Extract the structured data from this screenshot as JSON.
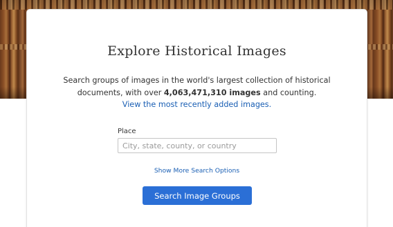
{
  "hero": {
    "image": "old-book-spines-banner"
  },
  "card": {
    "title": "Explore Historical Images",
    "description_before": "Search groups of images in the world's largest collection of historical documents, with over ",
    "image_count": "4,063,471,310 images",
    "description_after": " and counting.",
    "recent_link": "View the most recently added images."
  },
  "search": {
    "place_label": "Place",
    "place_placeholder": "City, state, county, or country",
    "place_value": "",
    "more_options_label": "Show More Search Options",
    "submit_label": "Search Image Groups"
  },
  "colors": {
    "link": "#1a5fb4",
    "button": "#2b6fd6",
    "text": "#333333"
  }
}
